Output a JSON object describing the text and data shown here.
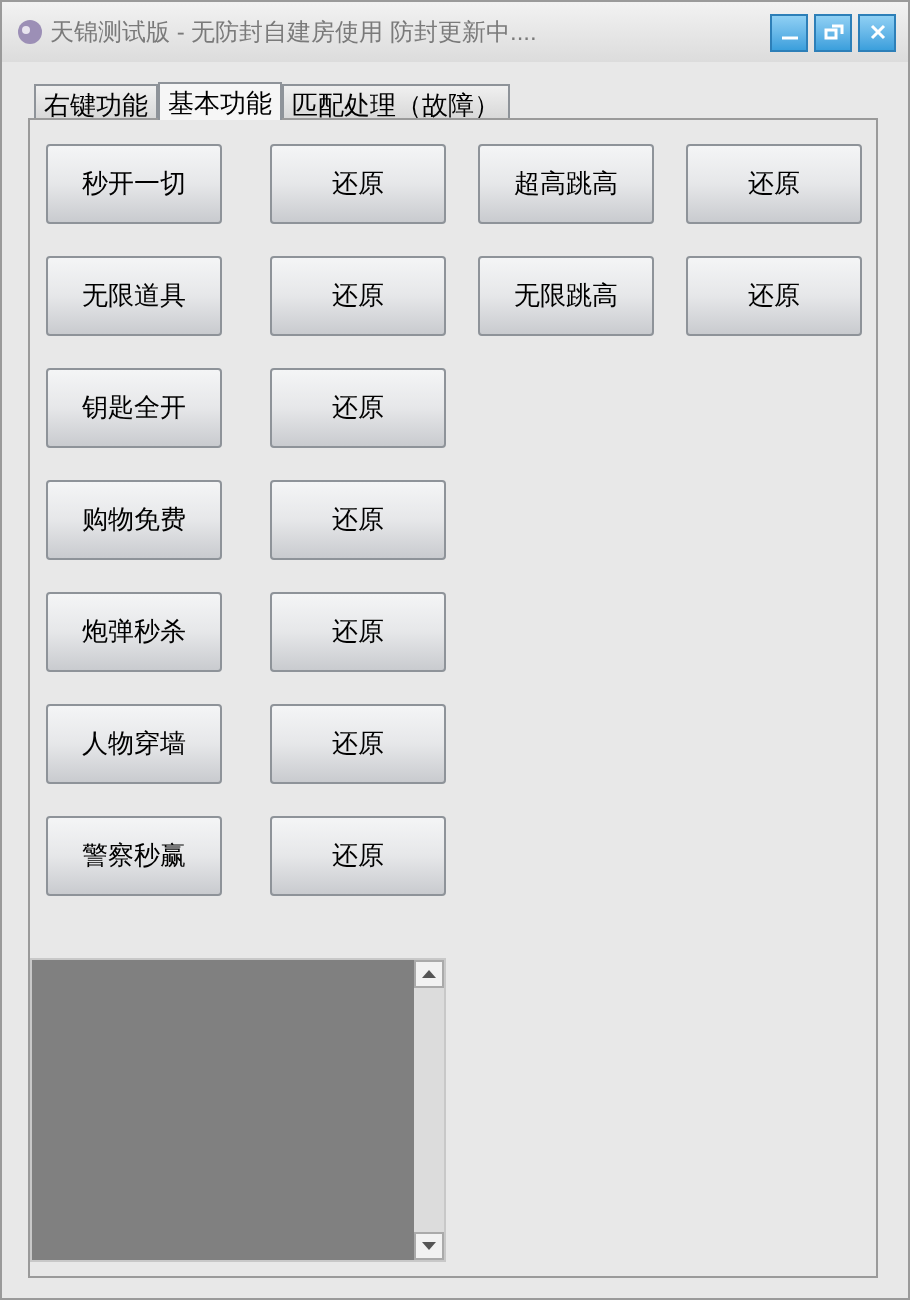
{
  "window": {
    "title": "天锦测试版 - 无防封自建房使用 防封更新中...."
  },
  "tabs": [
    {
      "label": "右键功能",
      "selected": false
    },
    {
      "label": "基本功能",
      "selected": true
    },
    {
      "label": "匹配处理（故障）",
      "selected": false
    }
  ],
  "button_rows": [
    [
      "秒开一切",
      "还原",
      "超高跳高",
      "还原"
    ],
    [
      "无限道具",
      "还原",
      "无限跳高",
      "还原"
    ],
    [
      "钥匙全开",
      "还原"
    ],
    [
      "购物免费",
      "还原"
    ],
    [
      "炮弹秒杀",
      "还原"
    ],
    [
      "人物穿墙",
      "还原"
    ],
    [
      "警察秒赢",
      "还原"
    ]
  ],
  "log": {
    "kind": "textarea"
  }
}
